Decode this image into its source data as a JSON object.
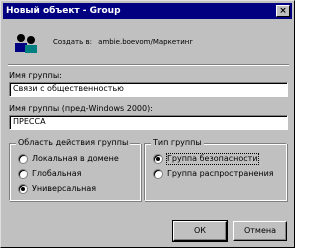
{
  "window": {
    "title": "Новый объект - Group",
    "close_glyph": "×"
  },
  "header": {
    "icon": "users-icon",
    "create_in_label": "Создать в:",
    "create_in_path": "ambie.boevom/Маркетинг"
  },
  "group_name": {
    "label": "Имя группы:",
    "value": "Связи с общественностью"
  },
  "group_name_pre2000": {
    "label": "Имя группы (пред-Windows 2000):",
    "value": "ПРЕССА"
  },
  "scope": {
    "legend": "Область действия группы",
    "options": [
      {
        "label": "Локальная в домене",
        "selected": false
      },
      {
        "label": "Глобальная",
        "selected": false
      },
      {
        "label": "Универсальная",
        "selected": true
      }
    ]
  },
  "type": {
    "legend": "Тип группы",
    "options": [
      {
        "label": "Группа безопасности",
        "selected": true
      },
      {
        "label": "Группа распространения",
        "selected": false
      }
    ]
  },
  "buttons": {
    "ok": "ОК",
    "cancel": "Отмена"
  }
}
